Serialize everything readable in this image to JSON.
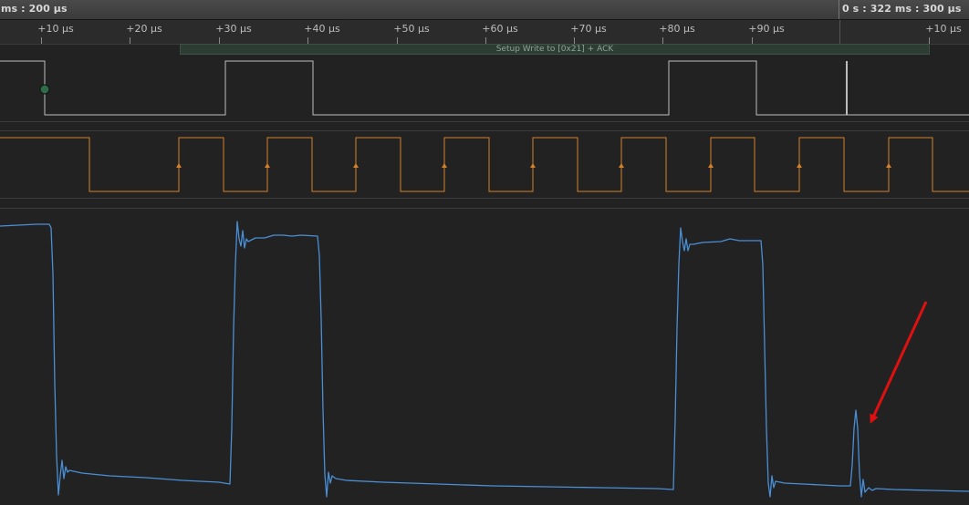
{
  "timebar": {
    "left_label": "ms : 200 µs",
    "right_label": "0 s : 322 ms : 300 µs"
  },
  "ruler": {
    "ticks": [
      "+10 µs",
      "+20 µs",
      "+30 µs",
      "+40 µs",
      "+50 µs",
      "+60 µs",
      "+70 µs",
      "+80 µs",
      "+90 µs",
      "+10 µs"
    ]
  },
  "decoder": {
    "label": "Setup Write to [0x21] + ACK"
  },
  "channels": {
    "digital_sda_color": "#bdbdbd",
    "digital_scl_color": "#d4802a",
    "analog_color": "#4a8fd6",
    "marker_dot_color": "#2e6b46",
    "annotation_arrow_color": "#e01010"
  }
}
